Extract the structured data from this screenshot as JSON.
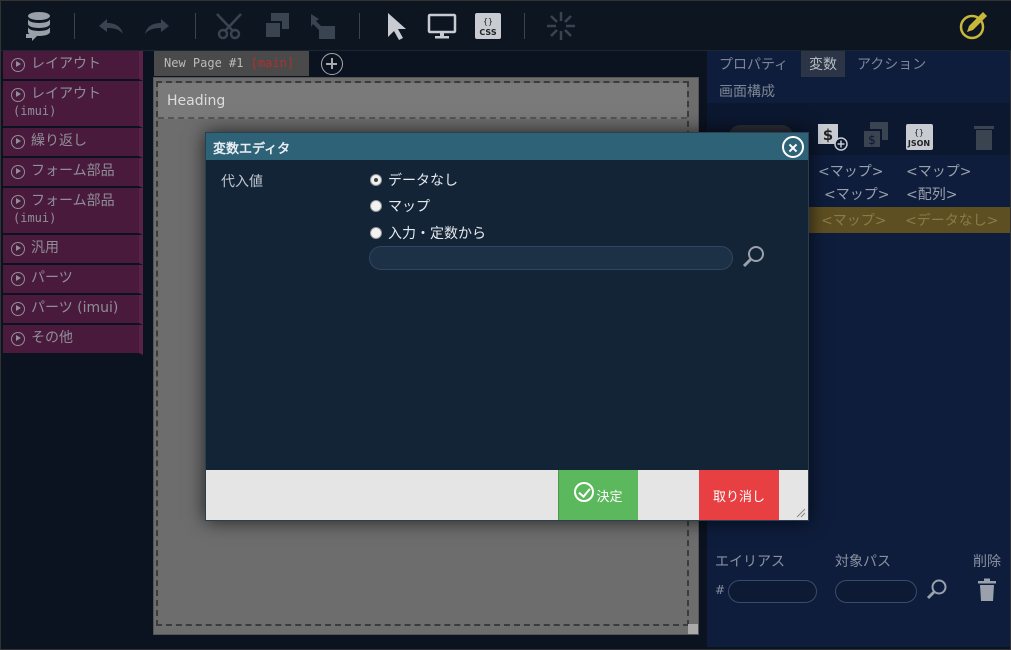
{
  "toolbar": {
    "icons": [
      "database-icon",
      "undo-icon",
      "redo-icon",
      "cut-icon",
      "copy-icon",
      "paste-icon",
      "pointer-icon",
      "monitor-icon",
      "css-icon",
      "sparkle-icon",
      "edit-icon"
    ],
    "css_label": "CSS"
  },
  "sidebar": {
    "items": [
      {
        "label": "レイアウト",
        "sub": ""
      },
      {
        "label": "レイアウト",
        "sub": "(imui)"
      },
      {
        "label": "繰り返し",
        "sub": ""
      },
      {
        "label": "フォーム部品",
        "sub": ""
      },
      {
        "label": "フォーム部品",
        "sub": "(imui)"
      },
      {
        "label": "汎用",
        "sub": ""
      },
      {
        "label": "パーツ",
        "sub": ""
      },
      {
        "label": "パーツ (imui)",
        "sub": ""
      },
      {
        "label": "その他",
        "sub": ""
      }
    ]
  },
  "page": {
    "tab_name": "New Page #1",
    "branch": "[main]",
    "heading": "Heading"
  },
  "right_panel": {
    "tabs": [
      "プロパティ",
      "変数",
      "アクション",
      "画面構成"
    ],
    "json_label": "JSON",
    "var_rows": [
      [
        "<マップ>",
        "<マップ>"
      ],
      [
        "<マップ>",
        "<配列>"
      ]
    ],
    "gold_row": [
      "<マップ>",
      "<データなし>"
    ],
    "alias_headers": {
      "alias": "エイリアス",
      "path": "対象パス",
      "delete": "削除"
    },
    "alias_prefix": "#"
  },
  "dialog": {
    "title": "変数エディタ",
    "field_label": "代入値",
    "options": [
      "データなし",
      "マップ",
      "入力・定数から"
    ],
    "selected": "データなし",
    "ok_label": "決定",
    "cancel_label": "取り消し"
  },
  "colors": {
    "dialog_title_bg": "#2e6277",
    "ok_button": "#5cb85c",
    "cancel_button": "#e84042",
    "sidebar_item": "#4a1a3c",
    "gold_row": "#5e4f22"
  }
}
